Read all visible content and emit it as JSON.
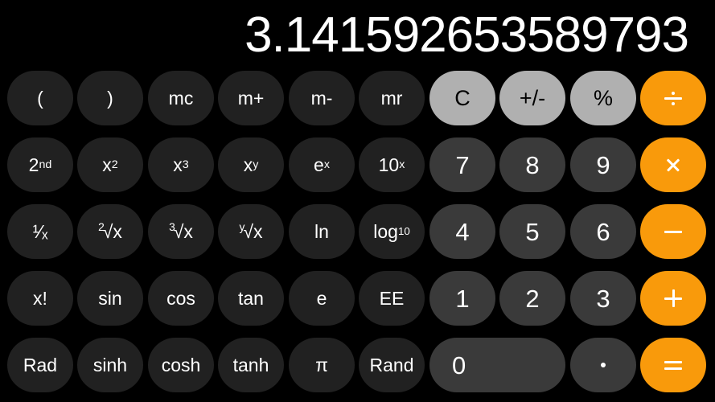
{
  "app": {
    "name": "Calculator",
    "mode": "scientific",
    "background_color": "#000000"
  },
  "display": {
    "value": "3.141592653589793"
  },
  "colors": {
    "accent_orange": "#f99a0b",
    "function_key": "#212121",
    "number_key": "#3a3a3a",
    "light_key": "#b0b0b0",
    "text": "#ffffff"
  },
  "keys": {
    "row1": {
      "open_paren": "(",
      "close_paren": ")",
      "memory_clear": "mc",
      "memory_add": "m+",
      "memory_subtract": "m-",
      "memory_recall": "mr",
      "clear": "C",
      "sign_toggle": "+/-",
      "percent": "%",
      "divide": "÷"
    },
    "row2": {
      "second": "2nd",
      "second_base": "2",
      "second_sup": "nd",
      "x_squared": "x²",
      "x_squared_base": "x",
      "x_squared_sup": "2",
      "x_cubed": "x³",
      "x_cubed_base": "x",
      "x_cubed_sup": "3",
      "x_to_y": "xʸ",
      "x_to_y_base": "x",
      "x_to_y_sup": "y",
      "e_to_x": "eˣ",
      "e_to_x_base": "e",
      "e_to_x_sup": "x",
      "ten_to_x": "10ˣ",
      "ten_to_x_base": "10",
      "ten_to_x_sup": "x",
      "seven": "7",
      "eight": "8",
      "nine": "9",
      "multiply": "×"
    },
    "row3": {
      "reciprocal": "1/x",
      "reciprocal_frac": "¹⁄ₓ",
      "sqrt2": "²√x",
      "sqrt2_index": "2",
      "sqrt2_body": "√x",
      "sqrt3": "³√x",
      "sqrt3_index": "3",
      "sqrt3_body": "√x",
      "sqrty": "ʸ√x",
      "sqrty_index": "y",
      "sqrty_body": "√x",
      "natural_log": "ln",
      "log_base10": "log₁₀",
      "log_base10_base": "log",
      "log_base10_sub": "10",
      "four": "4",
      "five": "5",
      "six": "6",
      "subtract": "−"
    },
    "row4": {
      "factorial": "x!",
      "sin": "sin",
      "cos": "cos",
      "tan": "tan",
      "euler": "e",
      "ee": "EE",
      "one": "1",
      "two": "2",
      "three": "3",
      "add": "+"
    },
    "row5": {
      "rad": "Rad",
      "sinh": "sinh",
      "cosh": "cosh",
      "tanh": "tanh",
      "pi": "π",
      "rand": "Rand",
      "zero": "0",
      "decimal": ".",
      "equals": "="
    }
  }
}
